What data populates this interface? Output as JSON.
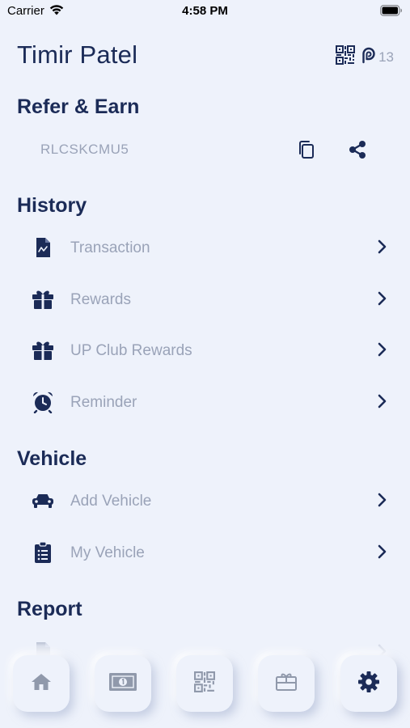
{
  "status_bar": {
    "carrier": "Carrier",
    "time": "4:58 PM"
  },
  "header": {
    "user_name": "Timir Patel",
    "points": "13"
  },
  "refer": {
    "title": "Refer & Earn",
    "code": "RLCSKCMU5"
  },
  "history": {
    "title": "History",
    "items": [
      {
        "label": "Transaction",
        "icon": "receipt-icon"
      },
      {
        "label": "Rewards",
        "icon": "gift-icon"
      },
      {
        "label": "UP Club Rewards",
        "icon": "gift-icon"
      },
      {
        "label": "Reminder",
        "icon": "alarm-clock-icon"
      }
    ]
  },
  "vehicle": {
    "title": "Vehicle",
    "items": [
      {
        "label": "Add Vehicle",
        "icon": "car-icon"
      },
      {
        "label": "My Vehicle",
        "icon": "clipboard-list-icon"
      }
    ]
  },
  "report": {
    "title": "Report"
  },
  "tabs": [
    {
      "icon": "home-icon",
      "active": false
    },
    {
      "icon": "money-icon",
      "active": false
    },
    {
      "icon": "qr-code-icon",
      "active": false
    },
    {
      "icon": "gift-card-icon",
      "active": false
    },
    {
      "icon": "gear-icon",
      "active": true
    }
  ],
  "colors": {
    "background": "#eef2fb",
    "primary": "#1b2b57",
    "muted": "#9aa3b8",
    "inactive_icon": "#9099ab"
  }
}
